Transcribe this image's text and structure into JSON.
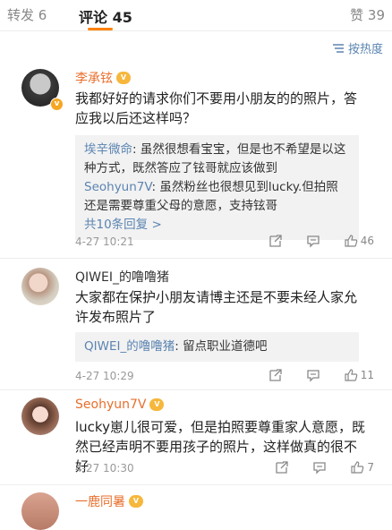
{
  "tabs": {
    "repost": "转发 6",
    "comment": "评论 45",
    "like": "赞 39"
  },
  "sort": {
    "label": "按热度"
  },
  "comments": [
    {
      "name": "李承铉",
      "text": "我都好好的请求你们不要用小朋友的的照片，答应我以后还这样吗？",
      "replies": [
        {
          "user": "埃辛微命",
          "text": "虽然很想看宝宝，但是也不希望是以这种方式，既然答应了铉哥就应该做到"
        },
        {
          "user": "Seohyun7V",
          "text": "虽然粉丝也很想见到lucky.但拍照还是需要尊重父母的意愿，支持铉哥"
        }
      ],
      "more": "共10条回复 >",
      "time": "4-27 10:21",
      "likes": "46"
    },
    {
      "name": "QIWEI_的噜噜猪",
      "text": "大家都在保护小朋友请博主还是不要未经人家允许发布照片了",
      "replies": [
        {
          "user": "QIWEI_的噜噜猪",
          "text": "留点职业道德吧"
        }
      ],
      "time": "4-27 10:29",
      "likes": "11"
    },
    {
      "name": "Seohyun7V",
      "text": "lucky崽儿很可爱，但是拍照要尊重家人意愿，既然已经声明不要用孩子的照片，这样做真的很不好",
      "time": "4-27 10:30",
      "likes": "7"
    },
    {
      "name": "一鹿同暑"
    }
  ],
  "colors": {
    "accent": "#ff8200",
    "link": "#5b84b1",
    "username": "#e86f2c"
  }
}
